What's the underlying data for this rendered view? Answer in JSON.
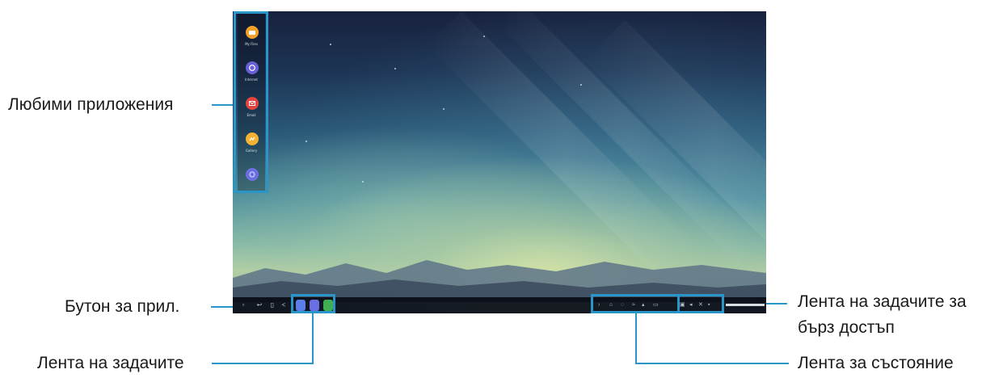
{
  "labels": {
    "favorite_apps": "Любими приложения",
    "apps_button": "Бутон за прил.",
    "taskbar": "Лента на задачите",
    "quick_access_line1": "Лента на задачите за",
    "quick_access_line2": "бърз достъп",
    "status_bar": "Лента за състояние"
  },
  "favorite_apps": [
    {
      "icon": "folder-icon",
      "color": "#f2a12b",
      "caption": "My Files"
    },
    {
      "icon": "internet-icon",
      "color": "#6a5fd8",
      "caption": "Internet"
    },
    {
      "icon": "email-icon",
      "color": "#e2463f",
      "caption": "Email"
    },
    {
      "icon": "gallery-icon",
      "color": "#f3b233",
      "caption": "Gallery"
    },
    {
      "icon": "circle-app-icon",
      "color": "#6c6fe0",
      "caption": ""
    }
  ],
  "taskbar": {
    "open_apps": [
      {
        "icon": "running-app-icon",
        "color": "#5b7ee8"
      },
      {
        "icon": "running-app-icon",
        "color": "#6b6fe4"
      },
      {
        "icon": "running-app-icon",
        "color": "#3fae54"
      }
    ],
    "status_icons": [
      "chevron-right-icon",
      "home-icon",
      "notification-icon",
      "wifi-icon",
      "signal-icon",
      "battery-icon"
    ],
    "quick_access_icons": [
      "screenshot-icon",
      "volume-icon",
      "close-icon",
      "menu-icon"
    ]
  },
  "colors": {
    "accent": "#2a95c9",
    "taskbar": "#080c16"
  }
}
